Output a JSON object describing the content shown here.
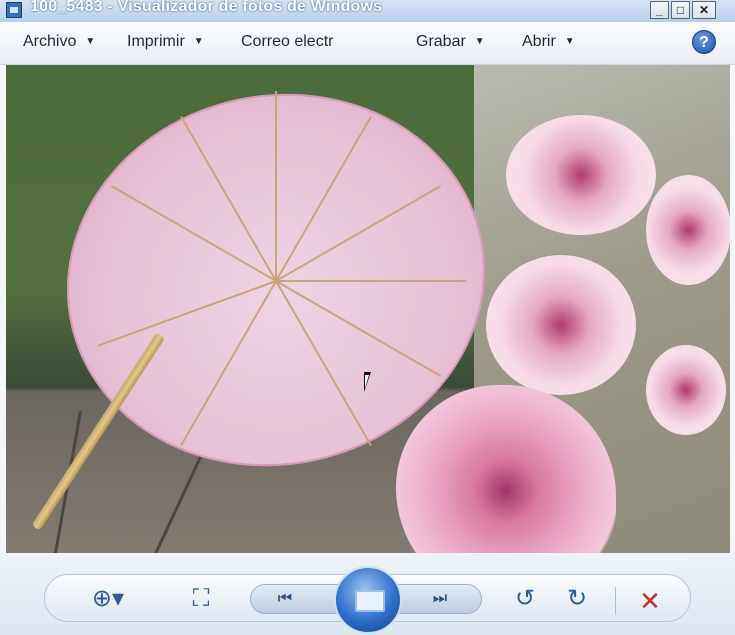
{
  "window": {
    "title": "100_5483 - Visualizador de fotos de Windows",
    "minimize_glyph": "_",
    "maximize_glyph": "□",
    "close_glyph": "✕"
  },
  "menubar": {
    "items": [
      {
        "label": "Archivo",
        "icon": "chevron-down-icon"
      },
      {
        "label": "Imprimir",
        "icon": "chevron-down-icon"
      },
      {
        "label": "Correo electr",
        "icon": ""
      },
      {
        "label": "Grabar",
        "icon": "chevron-down-icon"
      },
      {
        "label": "Abrir",
        "icon": "chevron-down-icon"
      }
    ],
    "help_glyph": "?"
  },
  "toolbar": {
    "zoom_glyph": "⊕▾",
    "fit_glyph": "⛶",
    "prev_glyph": "⏮",
    "next_glyph": "⏭",
    "rotate_ccw_glyph": "↺",
    "rotate_cw_glyph": "↻",
    "delete_glyph": "✕"
  },
  "colors": {
    "accent": "#2f6fcb",
    "delete": "#c0302a",
    "titlebar": "#b9cfea"
  }
}
